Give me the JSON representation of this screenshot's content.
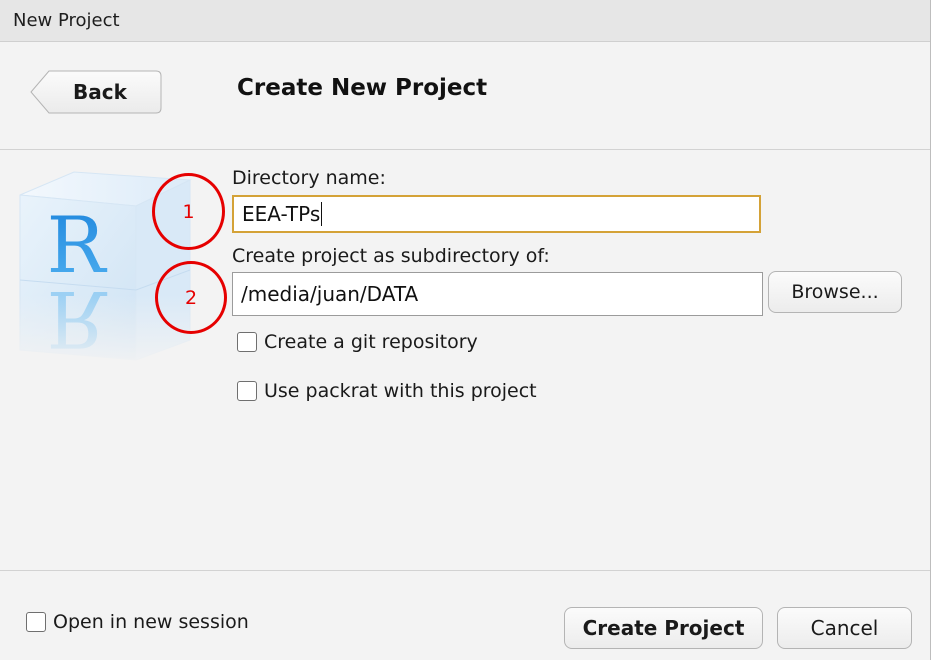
{
  "window": {
    "title": "New Project"
  },
  "header": {
    "back_label": "Back",
    "title": "Create New Project"
  },
  "logo": {
    "letter": "R",
    "icon": "r-project-cube-icon"
  },
  "annotations": [
    {
      "number": "1",
      "color": "#e60000"
    },
    {
      "number": "2",
      "color": "#e60000"
    }
  ],
  "form": {
    "directory_label": "Directory name:",
    "directory_value": "EEA-TPs",
    "subdirectory_label": "Create project as subdirectory of:",
    "subdirectory_value": "/media/juan/DATA",
    "browse_label": "Browse...",
    "git_label": "Create a git repository",
    "git_checked": false,
    "packrat_label": "Use packrat with this project",
    "packrat_checked": false
  },
  "footer": {
    "new_session_label": "Open in new session",
    "new_session_checked": false,
    "create_label": "Create Project",
    "cancel_label": "Cancel"
  },
  "colors": {
    "focus_border": "#d4a237",
    "annotation": "#e60000",
    "logo_blue": "#2a8fe0"
  }
}
